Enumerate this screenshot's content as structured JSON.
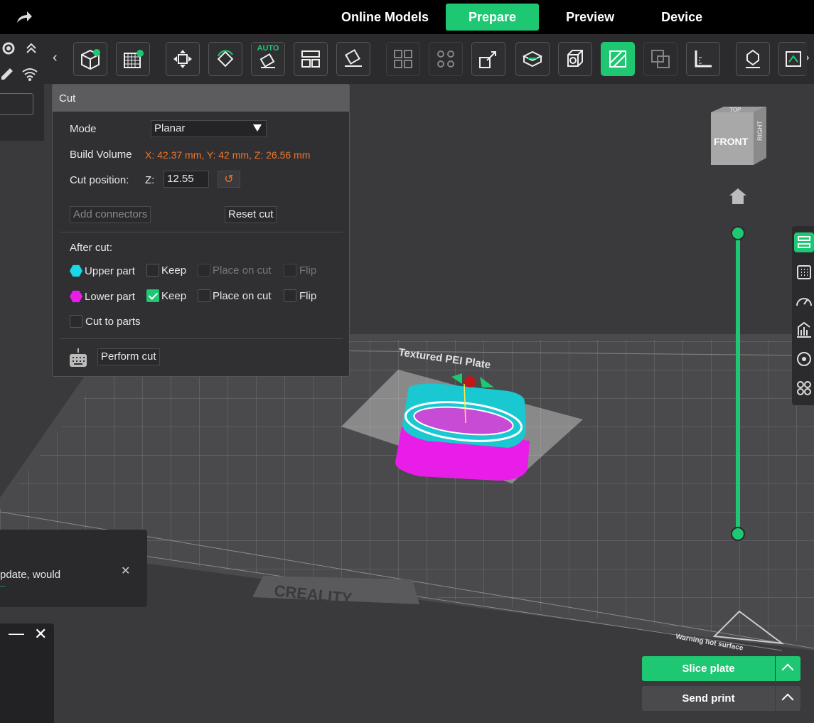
{
  "header": {
    "tabs": [
      {
        "label": "Online Models"
      },
      {
        "label": "Prepare"
      },
      {
        "label": "Preview"
      },
      {
        "label": "Device"
      }
    ],
    "active_tab": "Prepare"
  },
  "toolbar": {
    "auto_label": "AUTO",
    "prev_arrow": "‹",
    "next_arrow": "›"
  },
  "cut_panel": {
    "title": "Cut",
    "mode_label": "Mode",
    "mode_value": "Planar",
    "build_volume_label": "Build Volume",
    "build_volume_value": "X: 42.37 mm,  Y: 42 mm,  Z: 26.56 mm",
    "cut_position_label": "Cut position:",
    "axis_label": "Z:",
    "cut_position_value": "12.55",
    "add_connectors": "Add connectors",
    "reset_cut": "Reset cut",
    "after_cut_label": "After cut:",
    "upper_part": {
      "label": "Upper part",
      "keep": "Keep",
      "place_on_cut": "Place on cut",
      "flip": "Flip",
      "color": "#19d9e6"
    },
    "lower_part": {
      "label": "Lower part",
      "keep": "Keep",
      "place_on_cut": "Place on cut",
      "flip": "Flip",
      "color": "#e81ee8"
    },
    "cut_to_parts": "Cut to parts",
    "perform_cut": "Perform cut"
  },
  "plate": {
    "brand": "CREALITY",
    "plate_label": "Textured PEI Plate",
    "warning": "Warning hot surface"
  },
  "nav_cube": {
    "front": "FRONT",
    "top": "TOP",
    "right": "RIGHT"
  },
  "notification": {
    "text": "pdate, would",
    "close": "✕"
  },
  "mini_window": {
    "minimize": "—",
    "close": "✕"
  },
  "actions": {
    "slice": "Slice plate",
    "send": "Send print"
  },
  "colors": {
    "accent": "#1ec772",
    "warning": "#f0762a"
  }
}
